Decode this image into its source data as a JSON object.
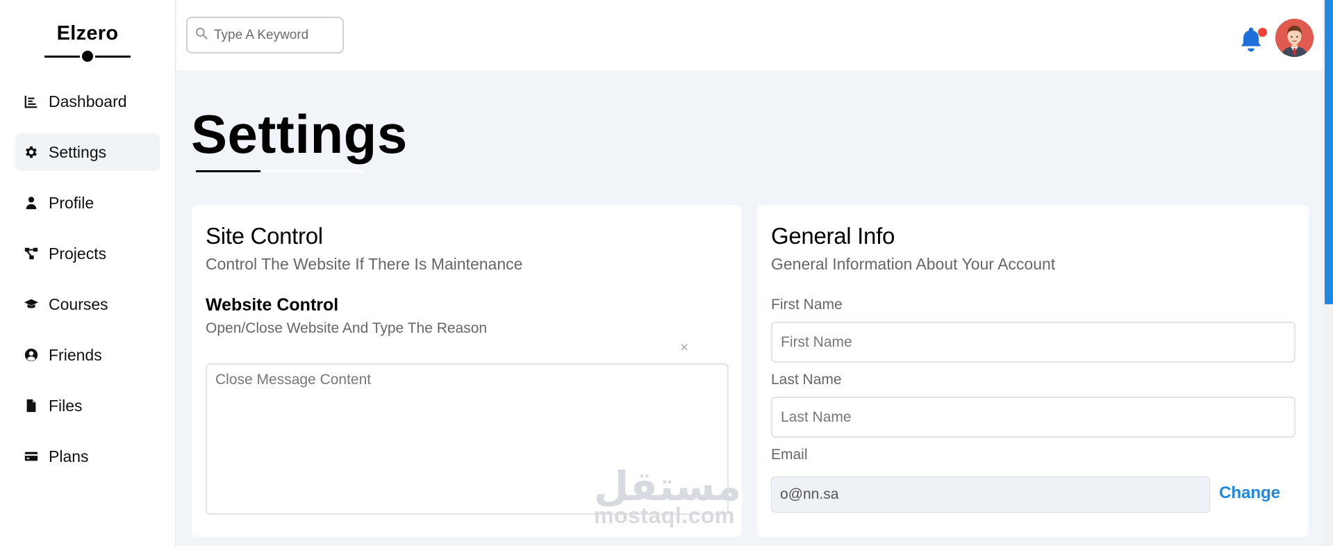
{
  "brand": {
    "name": "Elzero"
  },
  "sidebar": {
    "items": [
      {
        "label": "Dashboard",
        "icon": "chart-bar-icon",
        "active": false
      },
      {
        "label": "Settings",
        "icon": "gear-icon",
        "active": true
      },
      {
        "label": "Profile",
        "icon": "user-icon",
        "active": false
      },
      {
        "label": "Projects",
        "icon": "diagram-project-icon",
        "active": false
      },
      {
        "label": "Courses",
        "icon": "graduation-cap-icon",
        "active": false
      },
      {
        "label": "Friends",
        "icon": "user-circle-icon",
        "active": false
      },
      {
        "label": "Files",
        "icon": "file-icon",
        "active": false
      },
      {
        "label": "Plans",
        "icon": "credit-card-icon",
        "active": false
      }
    ]
  },
  "header": {
    "search": {
      "placeholder": "Type A Keyword",
      "value": ""
    },
    "notifications": {
      "icon": "bell-icon",
      "has_unread": true
    },
    "avatar": {
      "icon": "avatar-icon"
    }
  },
  "page": {
    "title": "Settings"
  },
  "site_control": {
    "title": "Site Control",
    "subtitle": "Control The Website If There Is Maintenance",
    "website_control": {
      "title": "Website Control",
      "subtitle": "Open/Close Website And Type The Reason",
      "close_glyph": "×",
      "message_placeholder": "Close Message Content"
    }
  },
  "general_info": {
    "title": "General Info",
    "subtitle": "General Information About Your Account",
    "first_name": {
      "label": "First Name",
      "placeholder": "First Name",
      "value": ""
    },
    "last_name": {
      "label": "Last Name",
      "placeholder": "Last Name",
      "value": ""
    },
    "email": {
      "label": "Email",
      "value": "o@nn.sa",
      "action_label": "Change"
    }
  },
  "watermark": {
    "arabic": "مستقل",
    "latin": "mostaql.com"
  },
  "colors": {
    "accent": "#1e88e5",
    "notification_dot": "#f44336",
    "avatar_bg": "#e05a4f",
    "page_bg": "#f1f5f9"
  }
}
